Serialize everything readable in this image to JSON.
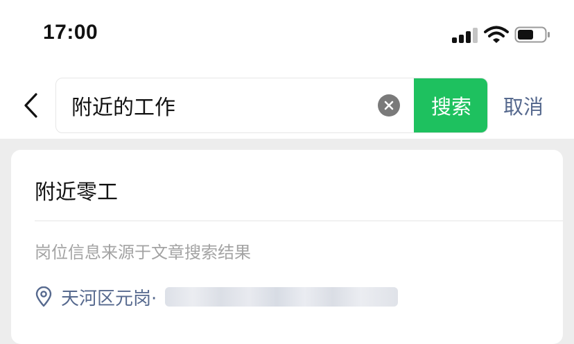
{
  "status_bar": {
    "time": "17:00",
    "icons": [
      "cellular-signal-icon",
      "wifi-icon",
      "battery-icon"
    ]
  },
  "header": {
    "back_icon": "chevron-left-icon",
    "search": {
      "value": "附近的工作",
      "clear_icon": "clear-circle-icon",
      "search_button_label": "搜索"
    },
    "cancel_label": "取消"
  },
  "result_card": {
    "title": "附近零工",
    "source_note": "岗位信息来源于文章搜索结果",
    "location": {
      "icon": "location-pin-icon",
      "text": "天河区元岗·"
    }
  },
  "colors": {
    "accent_green": "#1ec15f",
    "link_blue": "#56698e",
    "page_bg": "#ededed"
  }
}
